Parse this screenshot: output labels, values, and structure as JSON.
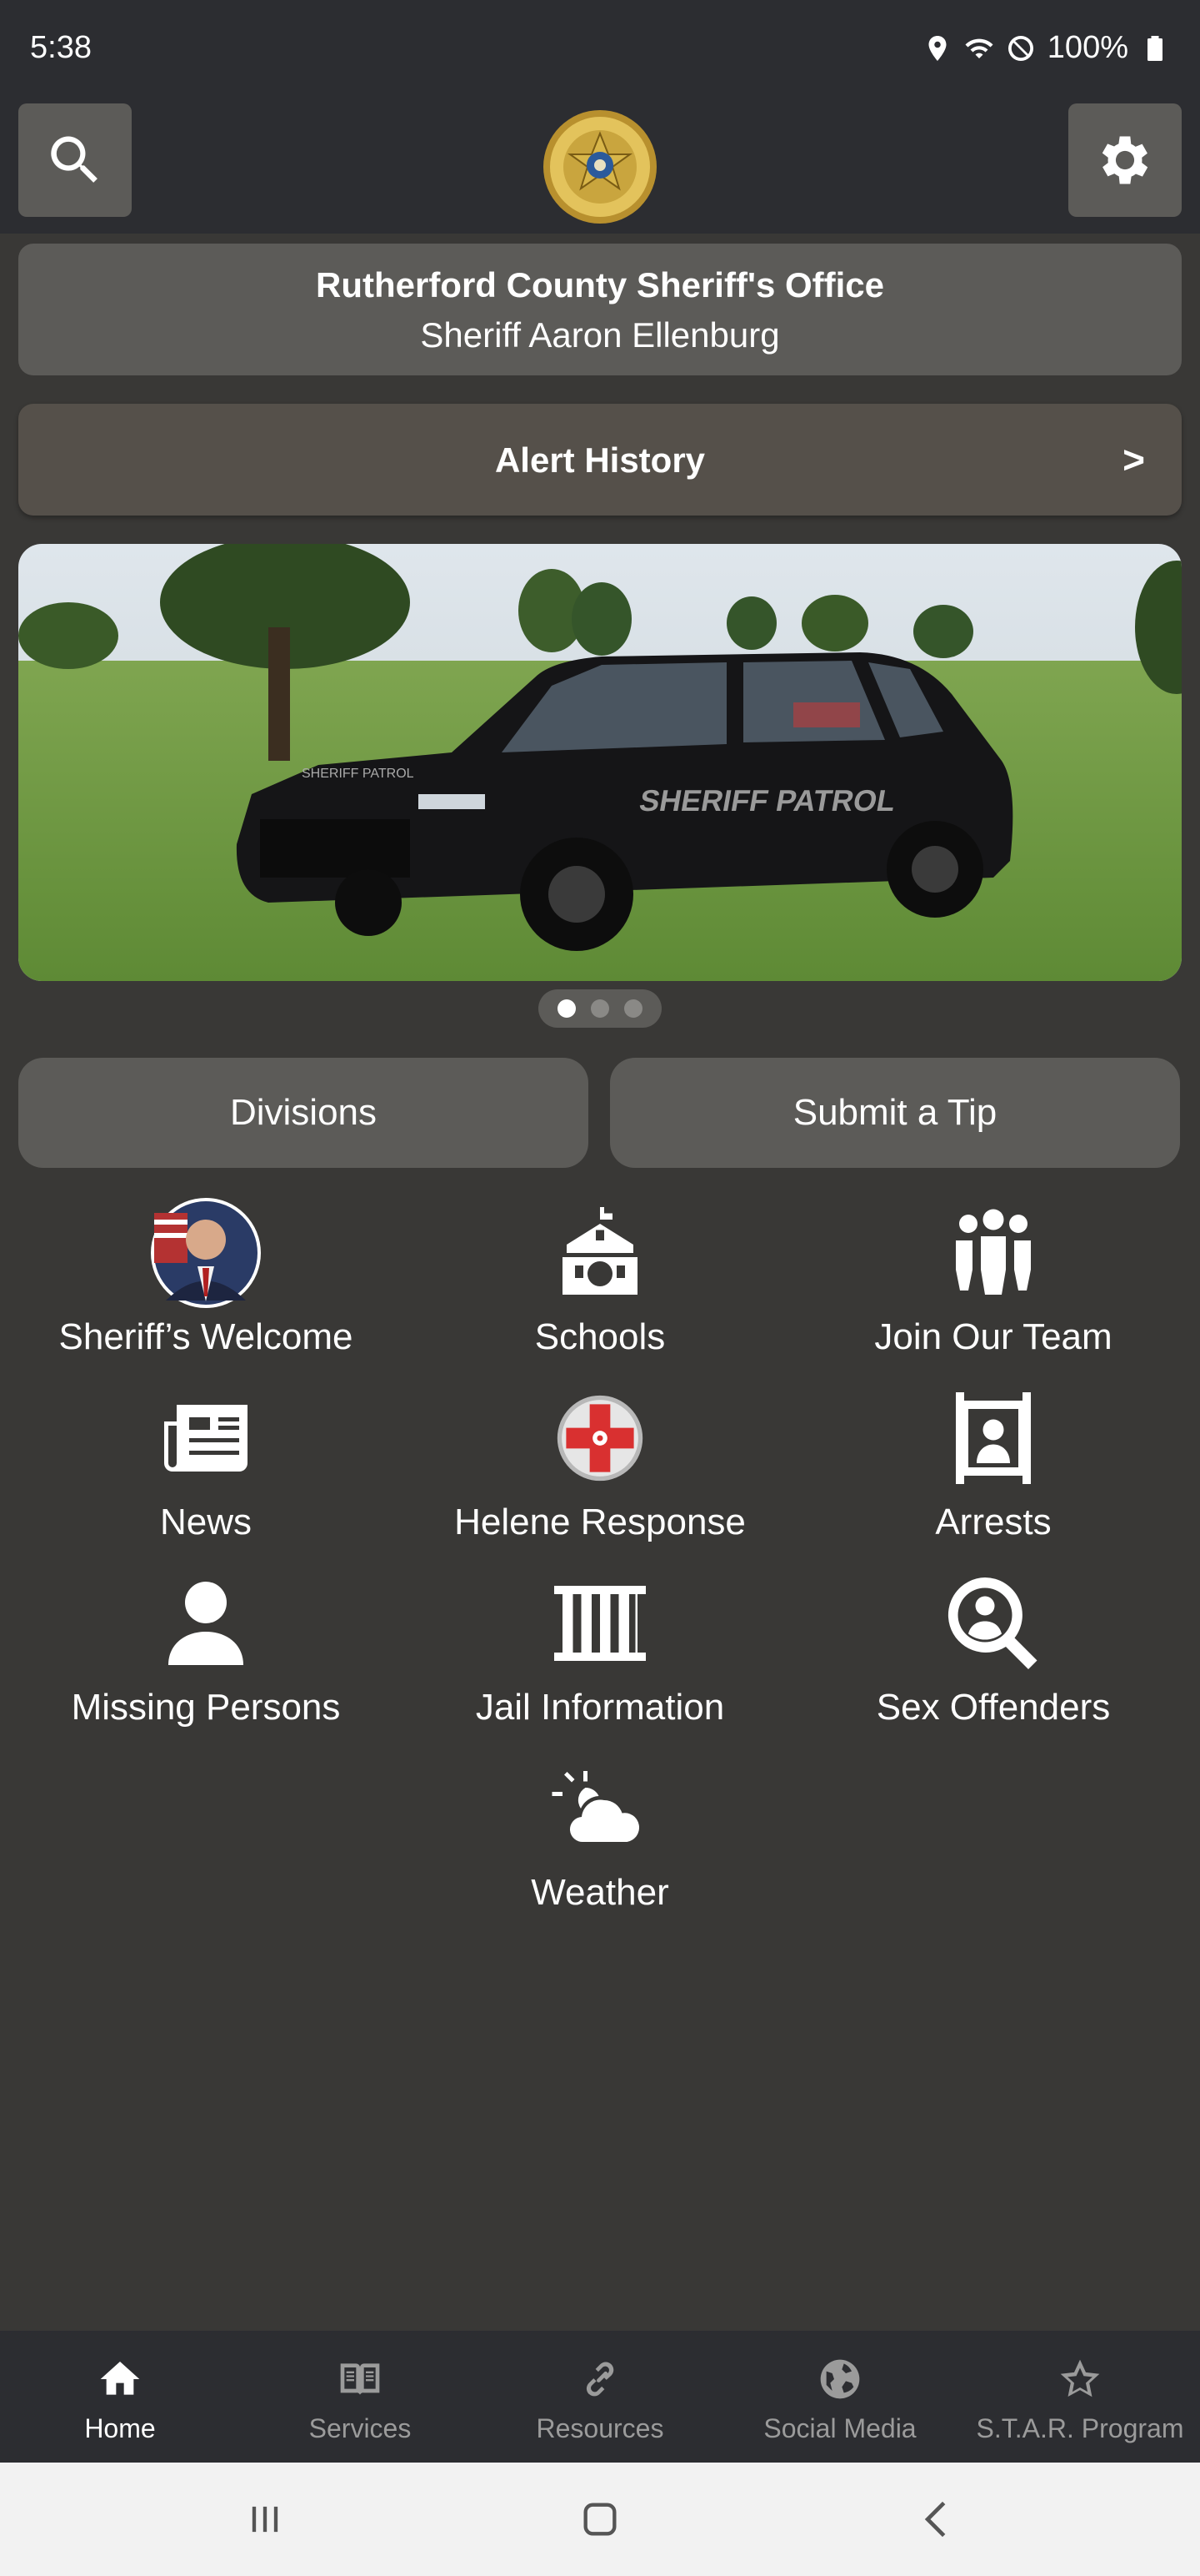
{
  "status_bar": {
    "time": "5:38",
    "battery": "100%"
  },
  "header": {
    "logo_icon": "sheriff-badge-logo",
    "search_icon": "search-icon",
    "settings_icon": "gear-icon"
  },
  "title_card": {
    "title": "Rutherford County Sheriff's Office",
    "subtitle": "Sheriff Aaron Ellenburg"
  },
  "alert_history": {
    "label": "Alert History",
    "chevron": ">"
  },
  "carousel": {
    "image": "sheriff patrol SUV on grass field",
    "total_slides": 3,
    "active_slide": 1
  },
  "buttons": {
    "divisions": "Divisions",
    "submit_tip": "Submit a Tip"
  },
  "grid": [
    {
      "label": "Sheriff’s Welcome",
      "icon": "sheriff-portrait-avatar"
    },
    {
      "label": "Schools",
      "icon": "school-icon"
    },
    {
      "label": "Join Our Team",
      "icon": "people-group-icon"
    },
    {
      "label": "News",
      "icon": "newspaper-icon"
    },
    {
      "label": "Helene Response",
      "icon": "red-cross-hurricane-icon"
    },
    {
      "label": "Arrests",
      "icon": "mugshot-icon"
    },
    {
      "label": "Missing Persons",
      "icon": "person-icon"
    },
    {
      "label": "Jail Information",
      "icon": "jail-bars-icon"
    },
    {
      "label": "Sex Offenders",
      "icon": "search-person-icon"
    },
    {
      "label": "Weather",
      "icon": "sun-cloud-icon"
    }
  ],
  "bottom_nav": [
    {
      "label": "Home",
      "icon": "home-icon",
      "active": true
    },
    {
      "label": "Services",
      "icon": "book-icon",
      "active": false
    },
    {
      "label": "Resources",
      "icon": "link-icon",
      "active": false
    },
    {
      "label": "Social Media",
      "icon": "globe-icon",
      "active": false
    },
    {
      "label": "S.T.A.R. Program",
      "icon": "star-icon",
      "active": false
    }
  ],
  "colors": {
    "background": "#393836",
    "bar": "#2c2d31",
    "card": "#5c5b58",
    "alert_card": "#55504a"
  }
}
